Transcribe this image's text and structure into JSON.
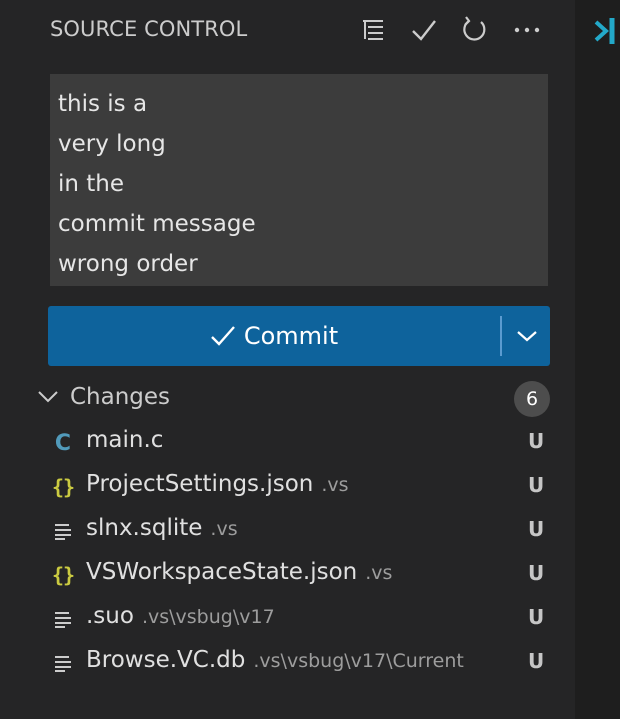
{
  "header": {
    "title": "SOURCE CONTROL",
    "icons": [
      "view-as-tree-icon",
      "check-icon",
      "refresh-icon",
      "more-actions-icon"
    ]
  },
  "commit_message": {
    "lines": [
      "this is a",
      "very long",
      "in the",
      "commit message",
      "wrong order"
    ]
  },
  "commit_button": {
    "label": "Commit"
  },
  "changes": {
    "label": "Changes",
    "count": "6",
    "files": [
      {
        "icon": "c-file-icon",
        "name": "main.c",
        "path": "",
        "status": "U"
      },
      {
        "icon": "json-file-icon",
        "name": "ProjectSettings.json",
        "path": ".vs",
        "status": "U"
      },
      {
        "icon": "text-file-icon",
        "name": "slnx.sqlite",
        "path": ".vs",
        "status": "U"
      },
      {
        "icon": "json-file-icon",
        "name": "VSWorkspaceState.json",
        "path": ".vs",
        "status": "U"
      },
      {
        "icon": "text-file-icon",
        "name": ".suo",
        "path": ".vs\\vsbug\\v17",
        "status": "U"
      },
      {
        "icon": "text-file-icon",
        "name": "Browse.VC.db",
        "path": ".vs\\vsbug\\v17\\Current",
        "status": "U"
      }
    ]
  },
  "colors": {
    "sidebar_bg": "#252526",
    "commit_button_bg": "#0e639c",
    "input_bg": "#3c3c3c",
    "accent_logo": "#23a9c9"
  }
}
